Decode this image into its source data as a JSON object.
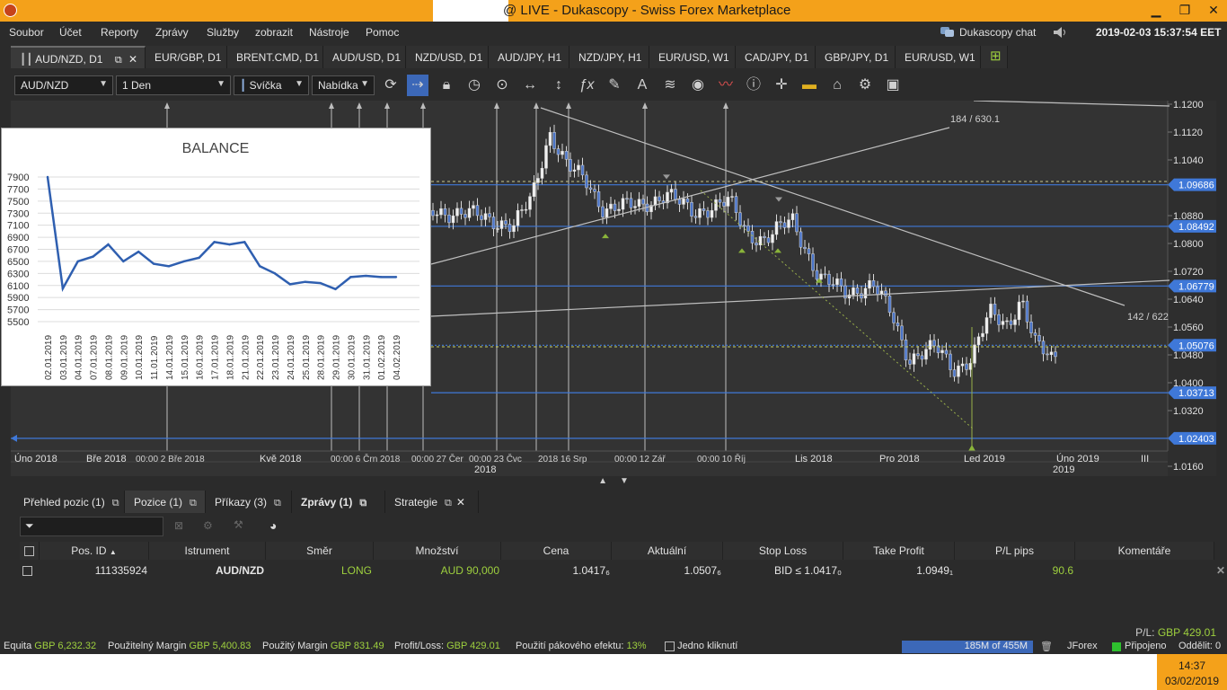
{
  "window": {
    "title": "@ LIVE - Dukascopy - Swiss Forex Marketplace",
    "minimize": "▁",
    "restore": "❐",
    "close": "✕"
  },
  "menu": [
    "Soubor",
    "Účet",
    "Reporty",
    "Zprávy",
    "Služby",
    "zobrazit",
    "Nástroje",
    "Pomoc"
  ],
  "header": {
    "chat_label": "Dukascopy chat",
    "datetime": "2019-02-03 15:37:54 EET"
  },
  "chart_tabs": [
    {
      "label": "AUD/NZD, D1",
      "active": true
    },
    {
      "label": "EUR/GBP, D1"
    },
    {
      "label": "BRENT.CMD, D1"
    },
    {
      "label": "AUD/USD, D1"
    },
    {
      "label": "NZD/USD, D1"
    },
    {
      "label": "AUD/JPY, H1"
    },
    {
      "label": "NZD/JPY, H1"
    },
    {
      "label": "EUR/USD, W1"
    },
    {
      "label": "CAD/JPY, D1"
    },
    {
      "label": "GBP/JPY, D1"
    },
    {
      "label": "EUR/USD, W1"
    }
  ],
  "toolbar": {
    "instrument": "AUD/NZD",
    "period": "1 Den",
    "chart_style": "Svíčka",
    "offer_side": "Nabídka"
  },
  "price_chart": {
    "price_axis": [
      "1.1200",
      "1.1120",
      "1.1040",
      "1.0880",
      "1.0800",
      "1.0720",
      "1.0640",
      "1.0560",
      "1.0480",
      "1.0400",
      "1.0320",
      "1.0160"
    ],
    "level_labels": [
      "1.09686",
      "1.08492",
      "1.06779",
      "1.05076",
      "1.03713",
      "1.02403"
    ],
    "line_annotations": [
      "184 / 630.1",
      "142 / 622"
    ],
    "time_axis": [
      "Úno 2018",
      "Bře 2018",
      "Kvě 2018",
      "Lis 2018",
      "Pro 2018",
      "Led 2019",
      "Úno 2019",
      "III"
    ],
    "year_labels": [
      "2018",
      "2019"
    ],
    "marker_labels": [
      "00:00 2 Bře 2018",
      "00:00 6 Črn 2018",
      "00:00 27 Čer",
      "00:00 23 Čvc",
      "2018 16 Srp",
      "00:00 12 Zář",
      "00:00 10 Říj"
    ]
  },
  "chart_data": {
    "type": "line",
    "title": "BALANCE",
    "categories": [
      "02.01.2019",
      "03.01.2019",
      "04.01.2019",
      "07.01.2019",
      "08.01.2019",
      "09.01.2019",
      "10.01.2019",
      "11.01.2019",
      "14.01.2019",
      "15.01.2019",
      "16.01.2019",
      "17.01.2019",
      "18.01.2019",
      "21.01.2019",
      "22.01.2019",
      "23.01.2019",
      "24.01.2019",
      "25.01.2019",
      "28.01.2019",
      "29.01.2019",
      "30.01.2019",
      "31.01.2019",
      "01.02.2019",
      "04.02.2019"
    ],
    "series": [
      {
        "values": [
          7900,
          6050,
          6500,
          6580,
          6780,
          6500,
          6660,
          6460,
          6420,
          6500,
          6560,
          6820,
          6780,
          6820,
          6420,
          6300,
          6120,
          6160,
          6140,
          6040,
          6240,
          6260,
          6240,
          6240
        ]
      }
    ],
    "yticks": [
      7900,
      7700,
      7500,
      7300,
      7100,
      6900,
      6700,
      6500,
      6300,
      6100,
      5900,
      5700,
      5500
    ],
    "ylim": [
      5500,
      7900
    ],
    "grid": true,
    "color": "#2f5fb0"
  },
  "bottom_tabs": [
    {
      "label": "Přehled pozic (1)"
    },
    {
      "label": "Pozice (1)",
      "active": true
    },
    {
      "label": "Příkazy (3)"
    },
    {
      "label": "Zprávy (1)",
      "bold": true
    },
    {
      "label": "Strategie"
    }
  ],
  "positions_table": {
    "columns": [
      "Pos. ID",
      "Istrument",
      "Směr",
      "Množství",
      "Cena",
      "Aktuální",
      "Stop Loss",
      "Take Profit",
      "P/L pips",
      "Komentáře"
    ],
    "row": {
      "pos_id": "111335924",
      "instrument": "AUD/NZD",
      "direction": "LONG",
      "amount": "AUD 90,000",
      "price": "1.0417₆",
      "current": "1.0507₆",
      "stop_loss": "BID ≤ 1.0417₀",
      "take_profit": "1.0949₁",
      "pl_pips": "90.6",
      "comment": ""
    },
    "pl_total_label": "P/L:",
    "pl_total_value": "GBP 429.01"
  },
  "status": {
    "equity_label": "Equita",
    "equity_value": "GBP 6,232.32",
    "usable_margin_label": "Použitelný Margin",
    "usable_margin_value": "GBP 5,400.83",
    "used_margin_label": "Použitý Margin",
    "used_margin_value": "GBP 831.49",
    "profit_loss_label": "Profit/Loss:",
    "profit_loss_value": "GBP 429.01",
    "leverage_label": "Použití pákového efektu:",
    "leverage_value": "13%",
    "one_click_label": "Jedno kliknutí",
    "memory": "185M of 455M",
    "platform": "JForex",
    "connection": "Připojeno",
    "detached": "Oddělit: 0"
  },
  "taskbar": {
    "time": "14:37",
    "date": "03/02/2019"
  }
}
